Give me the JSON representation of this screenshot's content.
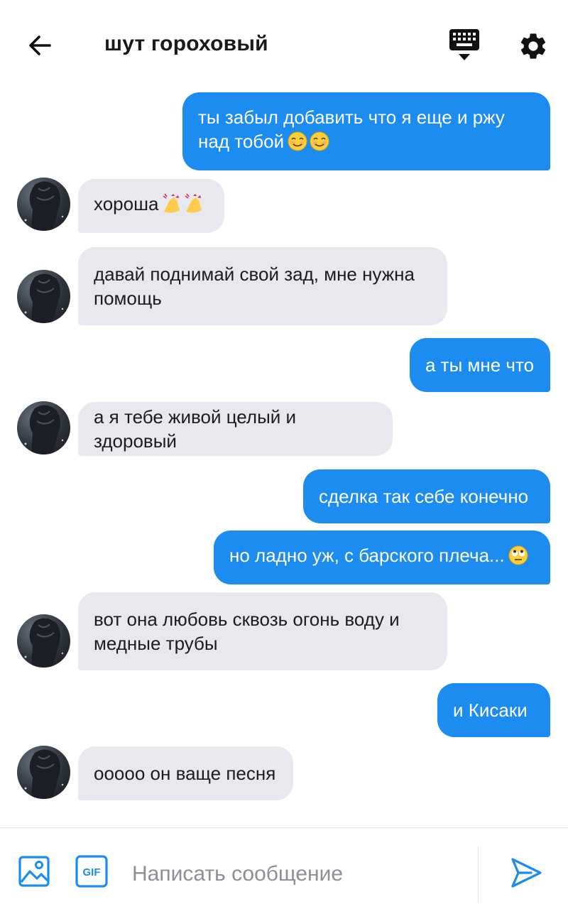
{
  "header": {
    "title": "шут гороховый"
  },
  "messages": [
    {
      "side": "out",
      "text": "ты забыл добавить что я еще и ржу\nнад тобой",
      "emoji": "☺️☺️"
    },
    {
      "side": "in",
      "text": "хороша",
      "emoji": "💅💅"
    },
    {
      "side": "in",
      "text": "давай поднимай свой зад, мне нужна\nпомощь"
    },
    {
      "side": "out",
      "text": "а ты мне что"
    },
    {
      "side": "in",
      "text": "а я тебе живой целый и здоровый"
    },
    {
      "side": "out",
      "text": "сделка так себе конечно"
    },
    {
      "side": "out",
      "text": "но ладно уж, с барского плеча...",
      "emoji": "🙄"
    },
    {
      "side": "in",
      "text": "вот она любовь сквозь огонь воду и\nмедные трубы"
    },
    {
      "side": "out",
      "text": "и Кисаки"
    },
    {
      "side": "in",
      "text": "ооооо он ваще песня"
    }
  ],
  "composer": {
    "placeholder": "Написать сообщение",
    "gif_label": "GIF"
  },
  "colors": {
    "accent": "#1c8cf0",
    "incoming_bubble": "#e8e9ee",
    "text_dark": "#1c1c1c"
  },
  "icons": {
    "back": "back-arrow-icon",
    "keyboard": "keyboard-icon",
    "settings": "gear-icon",
    "image": "image-icon",
    "gif": "gif-icon",
    "send": "send-icon"
  }
}
